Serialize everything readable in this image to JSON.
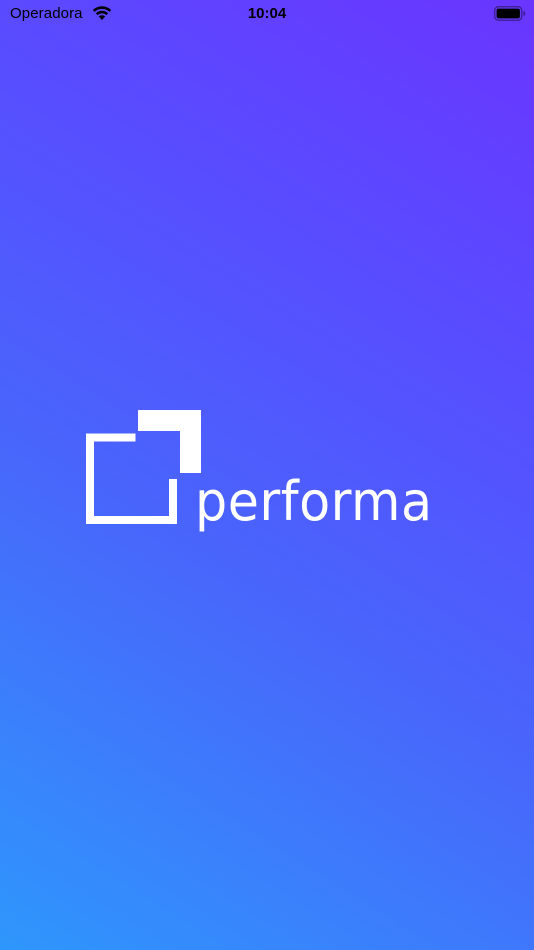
{
  "status_bar": {
    "carrier": "Operadora",
    "time": "10:04",
    "wifi_icon": "wifi-icon",
    "battery_icon": "battery-full-icon"
  },
  "splash": {
    "brand_name": "performa",
    "logo_icon": "performa-bracket-logo-icon"
  },
  "colors": {
    "gradient_top_right": "#6a35ff",
    "gradient_bottom_left": "#2e97fc",
    "logo_color": "#ffffff"
  }
}
